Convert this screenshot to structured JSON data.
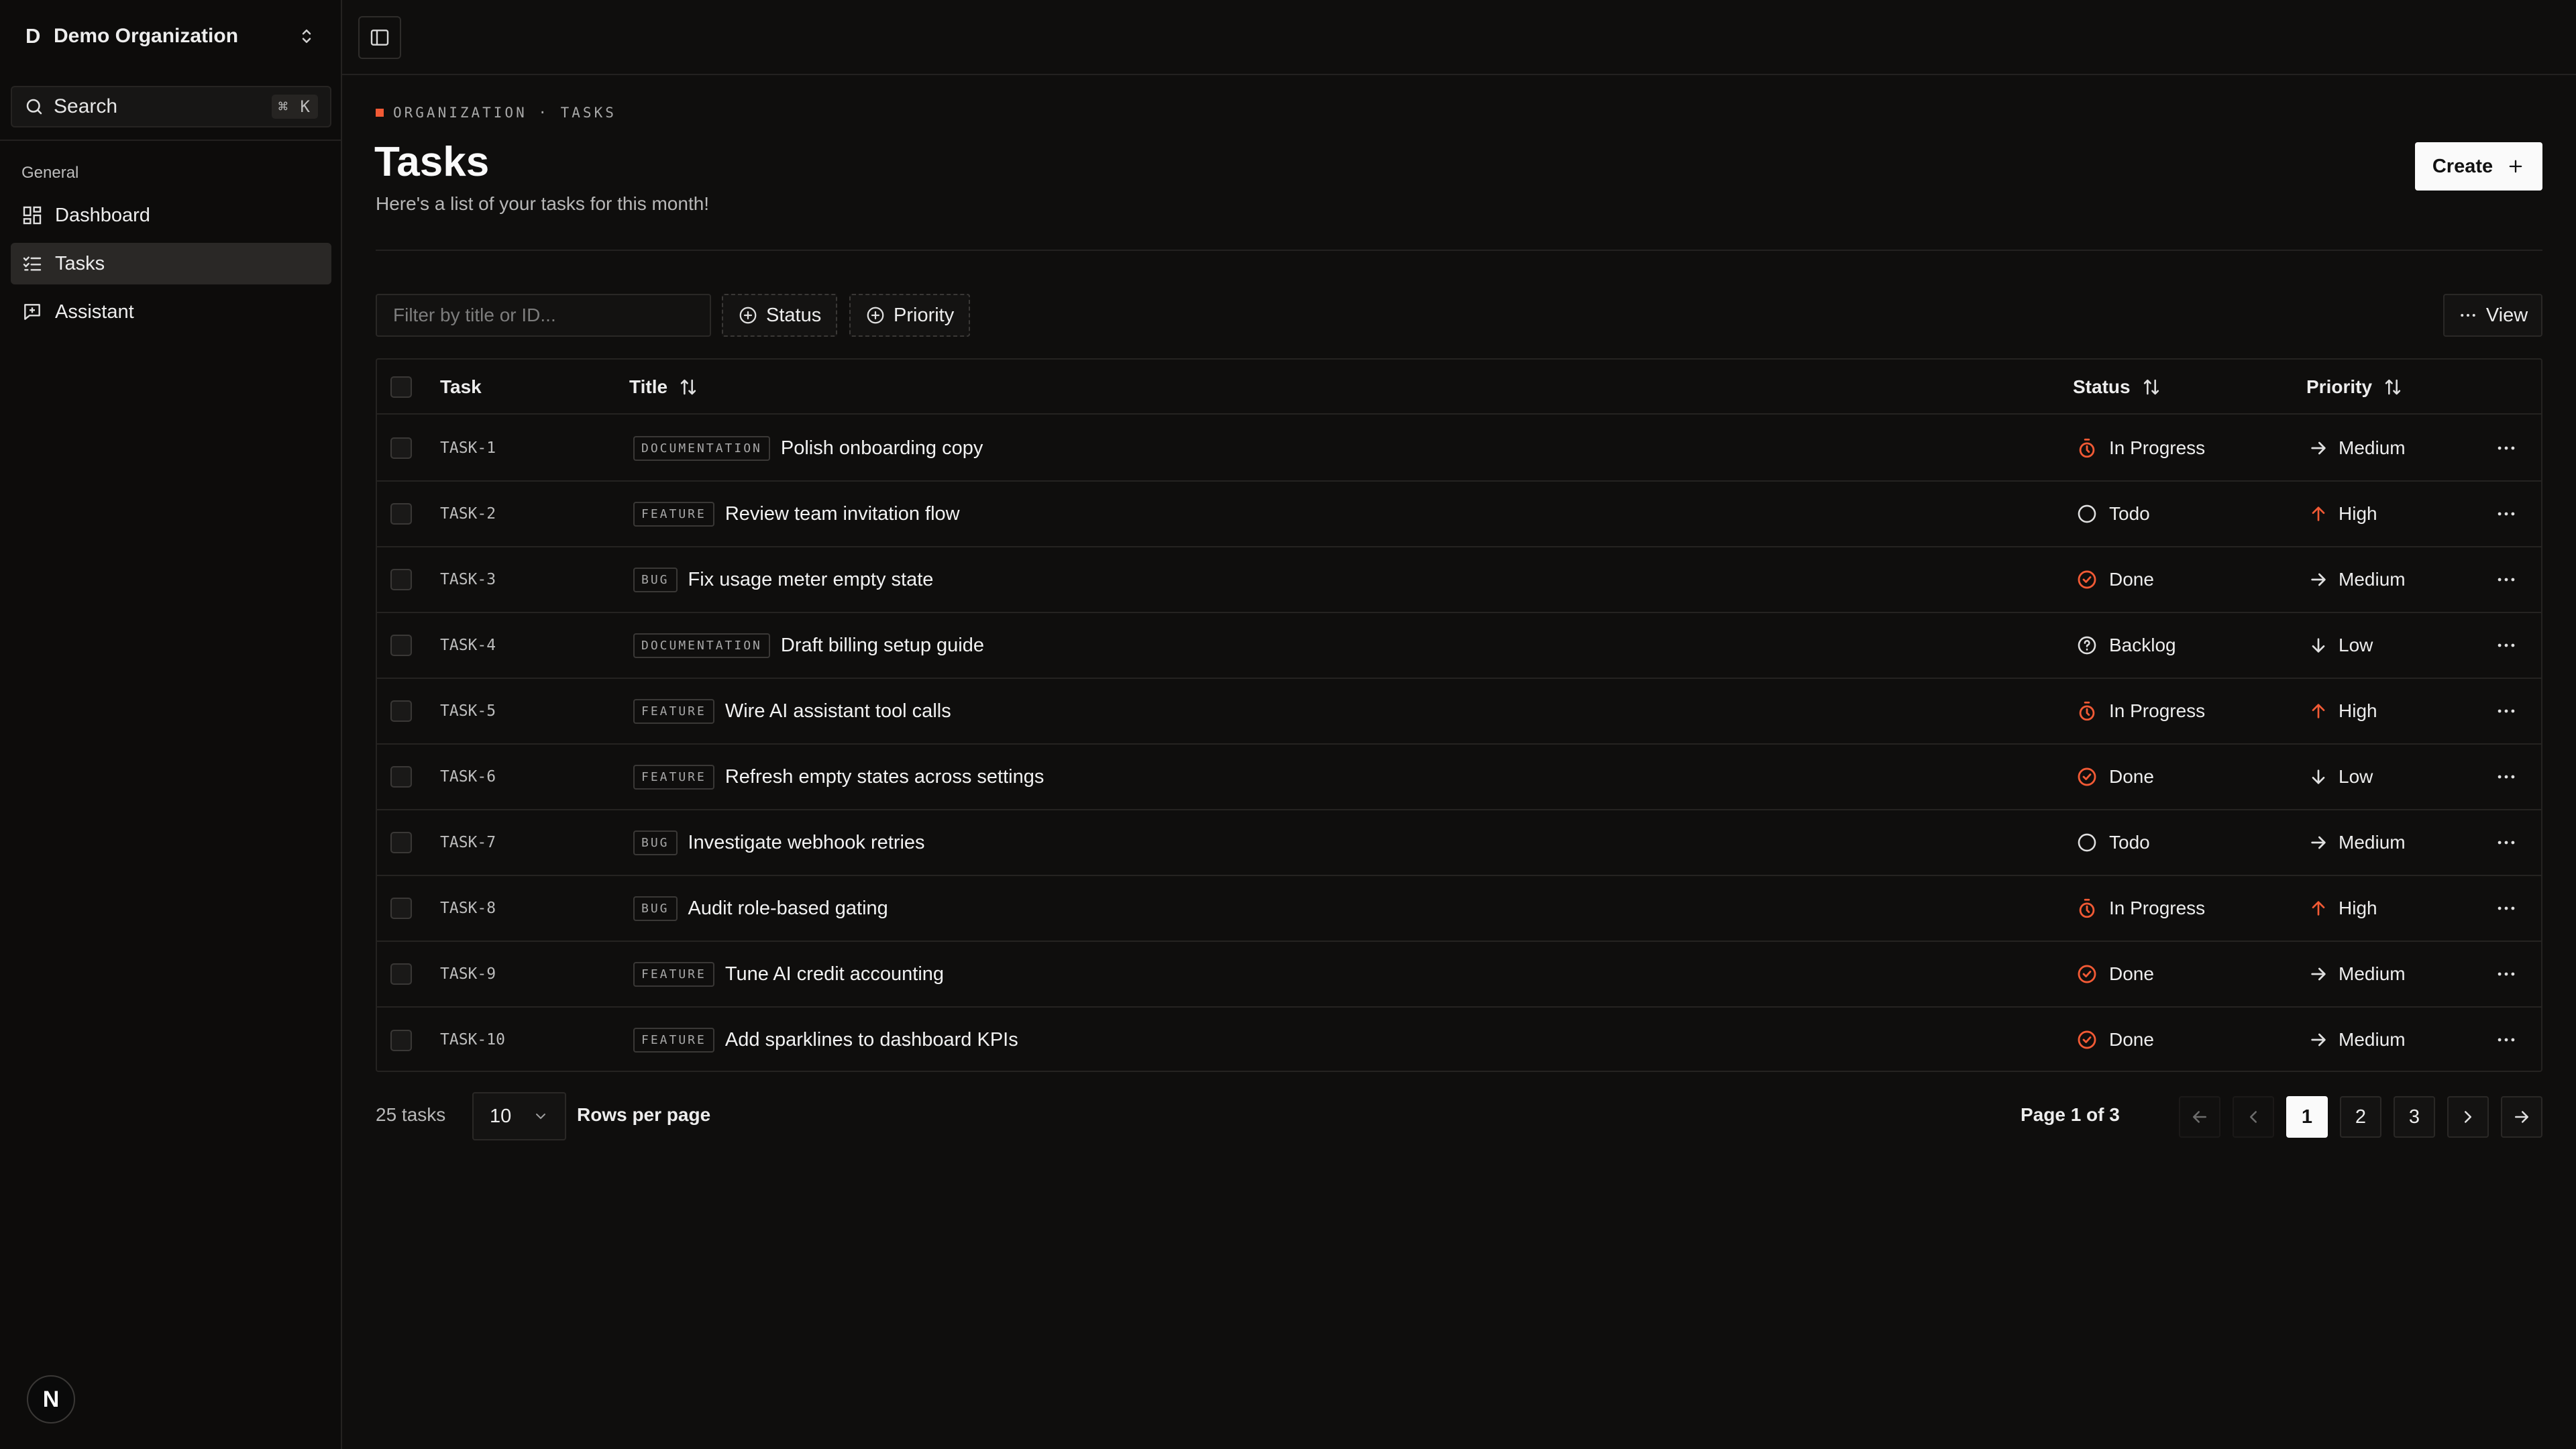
{
  "sidebar": {
    "org_initial": "D",
    "org_name": "Demo Organization",
    "search_label": "Search",
    "search_shortcut": "⌘ K",
    "group_label": "General",
    "items": [
      {
        "label": "Dashboard",
        "icon": "dashboard-icon"
      },
      {
        "label": "Tasks",
        "icon": "tasks-icon",
        "active": true
      },
      {
        "label": "Assistant",
        "icon": "assistant-icon"
      }
    ],
    "logo_letter": "N"
  },
  "header": {
    "breadcrumb": "ORGANIZATION · TASKS",
    "title": "Tasks",
    "subtitle": "Here's a list of your tasks for this month!",
    "create_label": "Create"
  },
  "toolbar": {
    "filter_placeholder": "Filter by title or ID...",
    "status_filter": "Status",
    "priority_filter": "Priority",
    "view_label": "View"
  },
  "table": {
    "columns": {
      "task": "Task",
      "title": "Title",
      "status": "Status",
      "priority": "Priority"
    },
    "rows": [
      {
        "id": "TASK-1",
        "label": "DOCUMENTATION",
        "title": "Polish onboarding copy",
        "status": "In Progress",
        "priority": "Medium"
      },
      {
        "id": "TASK-2",
        "label": "FEATURE",
        "title": "Review team invitation flow",
        "status": "Todo",
        "priority": "High"
      },
      {
        "id": "TASK-3",
        "label": "BUG",
        "title": "Fix usage meter empty state",
        "status": "Done",
        "priority": "Medium"
      },
      {
        "id": "TASK-4",
        "label": "DOCUMENTATION",
        "title": "Draft billing setup guide",
        "status": "Backlog",
        "priority": "Low"
      },
      {
        "id": "TASK-5",
        "label": "FEATURE",
        "title": "Wire AI assistant tool calls",
        "status": "In Progress",
        "priority": "High"
      },
      {
        "id": "TASK-6",
        "label": "FEATURE",
        "title": "Refresh empty states across settings",
        "status": "Done",
        "priority": "Low"
      },
      {
        "id": "TASK-7",
        "label": "BUG",
        "title": "Investigate webhook retries",
        "status": "Todo",
        "priority": "Medium"
      },
      {
        "id": "TASK-8",
        "label": "BUG",
        "title": "Audit role-based gating",
        "status": "In Progress",
        "priority": "High"
      },
      {
        "id": "TASK-9",
        "label": "FEATURE",
        "title": "Tune AI credit accounting",
        "status": "Done",
        "priority": "Medium"
      },
      {
        "id": "TASK-10",
        "label": "FEATURE",
        "title": "Add sparklines to dashboard KPIs",
        "status": "Done",
        "priority": "Medium"
      }
    ]
  },
  "pagination": {
    "total": "25 tasks",
    "rows_per_page_value": "10",
    "rows_per_page_label": "Rows per page",
    "page_info": "Page 1 of 3",
    "pages": [
      "1",
      "2",
      "3"
    ],
    "current_page": "1"
  },
  "colors": {
    "accent": "#f25a35",
    "background": "#0f0e0d",
    "border": "#252321"
  }
}
